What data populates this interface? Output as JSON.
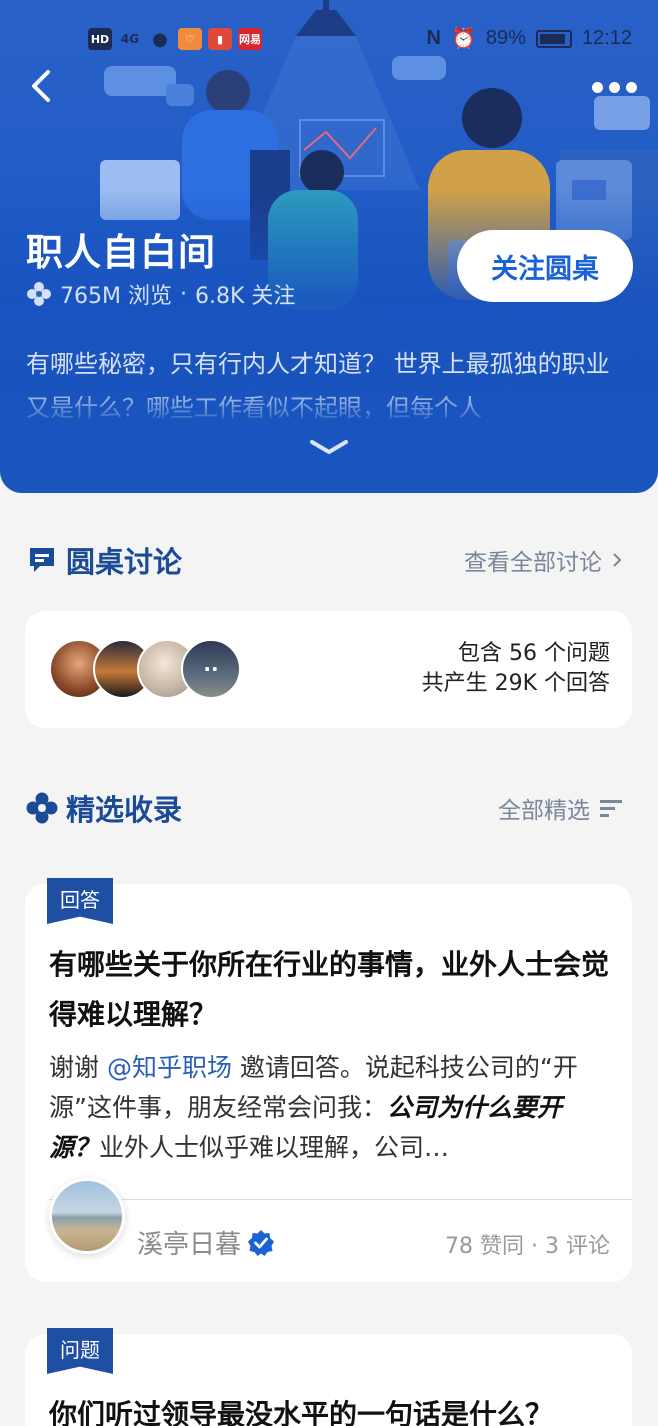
{
  "status_bar": {
    "left_icons": [
      "HD",
      "4G",
      "wechat-icon",
      "app-icon-1",
      "app-icon-2",
      "网易"
    ],
    "battery": "89%",
    "battery_level": 0.89,
    "time": "12:12"
  },
  "header": {
    "title": "职人自白间",
    "views": "765M 浏览",
    "separator": "·",
    "followers": "6.8K 关注",
    "follow_label": "关注圆桌",
    "description": "有哪些秘密，只有行内人才知道？ 世界上最孤独的职业又是什么？哪些工作看似不起眼，但每个人"
  },
  "discussion": {
    "heading": "圆桌讨论",
    "link": "查看全部讨论",
    "questions_count": "包含 56 个问题",
    "answers_count": "共产生 29K 个回答"
  },
  "featured": {
    "heading": "精选收录",
    "link": "全部精选"
  },
  "cards": [
    {
      "tag": "回答",
      "title": "有哪些关于你所在行业的事情，业外人士会觉得难以理解？",
      "body_prefix": "谢谢 ",
      "mention": "@知乎职场",
      "body_mid": " 邀请回答。说起科技公司的“开源”这件事，朋友经常会问我：",
      "body_em": "公司为什么要开源？",
      "body_suffix": "业外人士似乎难以理解，公司…",
      "author": "溪亭日暮",
      "meta": "78 赞同 · 3 评论"
    },
    {
      "tag": "问题",
      "title": "你们听过领导最没水平的一句话是什么？"
    }
  ],
  "colors": {
    "accent": "#1a63d6",
    "section_title": "#1b4a96",
    "header_bg": "#1f5bc6",
    "tag_bg": "#1f4fa3"
  }
}
